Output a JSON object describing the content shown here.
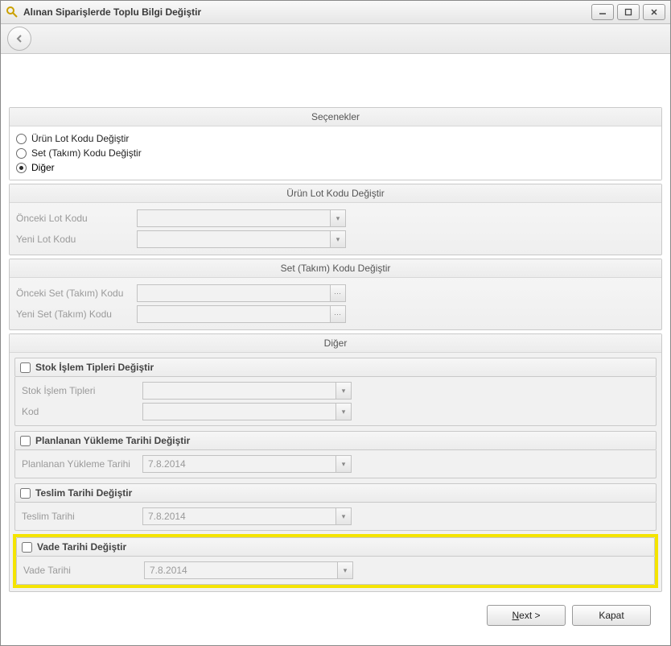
{
  "window": {
    "title": "Alınan Siparişlerde Toplu Bilgi Değiştir"
  },
  "options": {
    "header": "Seçenekler",
    "r1": "Ürün Lot Kodu Değiştir",
    "r2": "Set (Takım) Kodu Değiştir",
    "r3": "Diğer",
    "selected": "r3"
  },
  "lot": {
    "header": "Ürün Lot Kodu Değiştir",
    "prev_label": "Önceki Lot Kodu",
    "new_label": "Yeni Lot Kodu",
    "prev_value": "",
    "new_value": ""
  },
  "set": {
    "header": "Set (Takım) Kodu Değiştir",
    "prev_label": "Önceki Set (Takım) Kodu",
    "new_label": "Yeni Set (Takım) Kodu",
    "prev_value": "",
    "new_value": ""
  },
  "other": {
    "header": "Diğer",
    "stok": {
      "chk_label": "Stok İşlem Tipleri Değiştir",
      "tip_label": "Stok İşlem Tipleri",
      "kod_label": "Kod",
      "tip_value": "",
      "kod_value": ""
    },
    "plan": {
      "chk_label": "Planlanan Yükleme Tarihi Değiştir",
      "date_label": "Planlanan Yükleme Tarihi",
      "date_value": "7.8.2014"
    },
    "teslim": {
      "chk_label": "Teslim Tarihi Değiştir",
      "date_label": "Teslim Tarihi",
      "date_value": "7.8.2014"
    },
    "vade": {
      "chk_label": "Vade Tarihi Değiştir",
      "date_label": "Vade Tarihi",
      "date_value": "7.8.2014"
    }
  },
  "footer": {
    "next_prefix": "N",
    "next_suffix": "ext >",
    "close": "Kapat"
  }
}
